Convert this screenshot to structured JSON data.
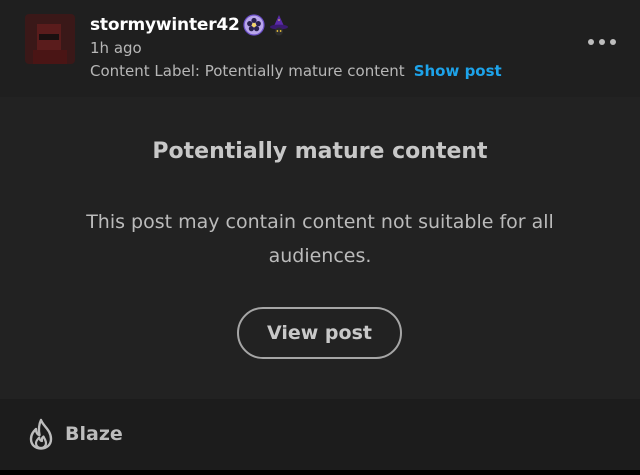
{
  "post": {
    "username": "stormywinter42",
    "timestamp": "1h ago",
    "content_label_text": "Content Label: Potentially mature content",
    "show_post_label": "Show post",
    "badges": [
      "flower-badge-icon",
      "witch-hat-badge-icon"
    ],
    "more_options_icon": "more-options-icon"
  },
  "warning": {
    "title": "Potentially mature content",
    "body": "This post may contain content not suitable for all audiences.",
    "view_post_label": "View post"
  },
  "footer": {
    "blaze_label": "Blaze",
    "blaze_icon": "flame-icon"
  },
  "colors": {
    "link": "#1da3ea",
    "card_background": "#222222",
    "header_background": "#1f1f1f",
    "footer_background": "#1c1c1c",
    "muted_text": "#b7b7b7"
  }
}
